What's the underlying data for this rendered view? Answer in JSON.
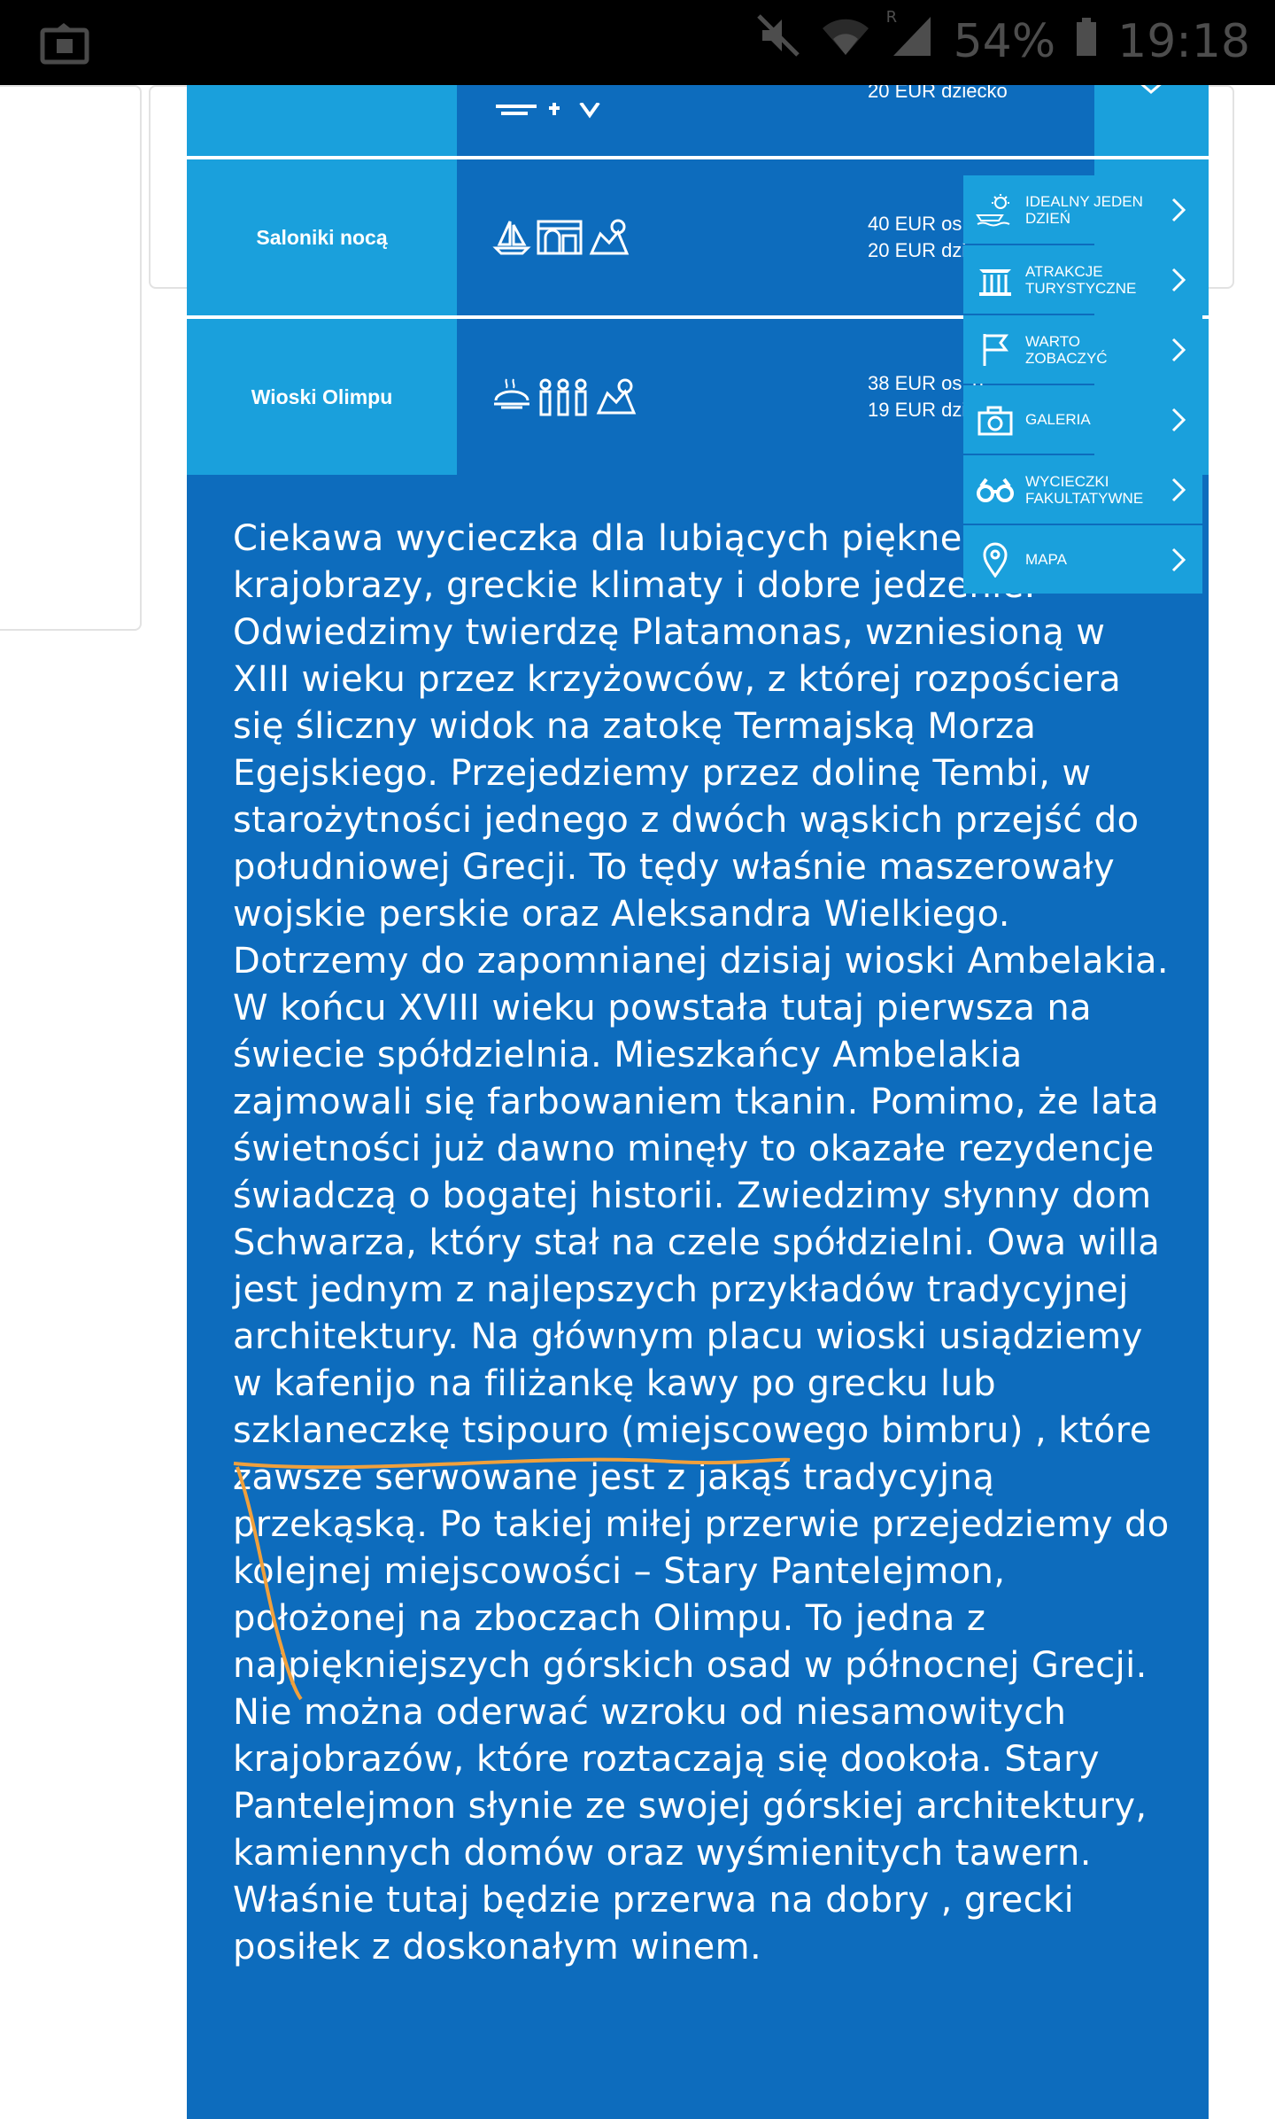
{
  "status_bar": {
    "battery": "54%",
    "time": "19:18",
    "signal_label": "R"
  },
  "table": {
    "rows": [
      {
        "name": "",
        "price_line1": "20 EUR dziecko",
        "price_line2": ""
      },
      {
        "name": "Saloniki nocą",
        "price_line1": "40 EUR os. d",
        "price_line2": "20 EUR dzie"
      },
      {
        "name": "Wioski Olimpu",
        "price_line1": "38 EUR os. d",
        "price_line2": "19 EUR dzie"
      }
    ]
  },
  "side_menu": {
    "items": [
      {
        "label": "IDEALNY JEDEN DZIEŃ",
        "icon": "sun-boat-icon"
      },
      {
        "label": "ATRAKCJE TURYSTYCZNE",
        "icon": "temple-icon"
      },
      {
        "label": "WARTO ZOBACZYĆ",
        "icon": "flag-icon"
      },
      {
        "label": "GALERIA",
        "icon": "camera-icon"
      },
      {
        "label": "WYCIECZKI FAKULTATYWNE",
        "icon": "binoculars-icon"
      },
      {
        "label": "MAPA",
        "icon": "map-pin-icon"
      }
    ]
  },
  "description": "Ciekawa wycieczka dla lubiących piękne krajobrazy, greckie klimaty i dobre jedzenie. Odwiedzimy twierdzę Platamonas, wzniesioną w XIII wieku przez krzyżowców, z której rozpościera się śliczny widok na zatokę Termajską Morza Egejskiego. Przejedziemy przez dolinę Tembi, w starożytności jednego z dwóch wąskich przejść do południowej Grecji. To tędy właśnie maszerowały wojskie perskie oraz Aleksandra Wielkiego. Dotrzemy do zapomnianej dzisiaj wioski Ambelakia. W końcu XVIII wieku powstała tutaj pierwsza na świecie spółdzielnia. Mieszkańcy Ambelakia zajmowali się farbowaniem tkanin. Pomimo, że lata świetności już dawno minęły to okazałe rezydencje świadczą o bogatej historii. Zwiedzimy słynny dom Schwarza, który stał na czele spółdzielni. Owa willa jest jednym z najlepszych przykładów tradycyjnej architektury. Na głównym placu wioski usiądziemy w kafenijo na filiżankę kawy po grecku lub szklaneczkę tsipouro (miejscowego bimbru) , które zawsze serwowane jest z jakąś tradycyjną przekąską. Po takiej miłej przerwie przejedziemy do kolejnej miejscowości – Stary Pantelejmon, położonej na zboczach Olimpu. To jedna z najpiękniejszych górskich osad w północnej Grecji. Nie można oderwać wzroku od niesamowitych krajobrazów, które roztaczają się dookoła. Stary Pantelejmon słynie ze swojej górskiej architektury, kamiennych domów oraz wyśmienitych tawern. Właśnie tutaj będzie przerwa na dobry , grecki posiłek z doskonałym winem.",
  "colors": {
    "dark_blue": "#0d6cbd",
    "light_blue": "#1aa0dc",
    "annotation": "#f0a03c"
  }
}
